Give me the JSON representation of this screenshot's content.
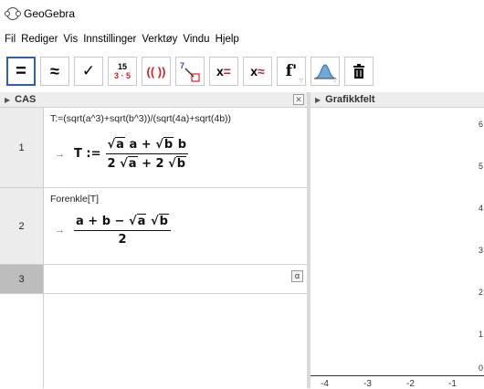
{
  "window": {
    "title": "GeoGebra"
  },
  "menu": [
    "Fil",
    "Rediger",
    "Vis",
    "Innstillinger",
    "Verktøy",
    "Vindu",
    "Hjelp"
  ],
  "toolbar": {
    "tools": [
      {
        "name": "evaluate-tool",
        "glyph": "="
      },
      {
        "name": "numeric-tool",
        "glyph": "≈"
      },
      {
        "name": "keep-input-tool",
        "glyph": "✓"
      },
      {
        "name": "factor-tool",
        "glyph_top": "15",
        "glyph_bottom": "3 · 5"
      },
      {
        "name": "expand-tool",
        "glyph": "(( ))"
      },
      {
        "name": "substitute-tool",
        "glyph": "7"
      },
      {
        "name": "solve-tool",
        "glyph": "x ="
      },
      {
        "name": "solve-numerically-tool",
        "glyph": "x ≈"
      },
      {
        "name": "derivative-tool",
        "glyph": "f'"
      },
      {
        "name": "probability-tool",
        "glyph": ""
      },
      {
        "name": "delete-tool",
        "glyph": ""
      }
    ]
  },
  "cas": {
    "header": "CAS",
    "rows": [
      {
        "number": "1",
        "input": "T:=(sqrt(a^3)+sqrt(b^3))/(sqrt(4a)+sqrt(4b))",
        "output_arrow": "→",
        "output_lhs": "T :=",
        "num_a": "a",
        "num_a2": "a",
        "num_plus": "+",
        "num_b": "b",
        "num_b2": "b",
        "den_2a": "2",
        "den_a": "a",
        "den_plus": "+ 2",
        "den_b": "b"
      },
      {
        "number": "2",
        "input": "Forenkle[T]",
        "output_arrow": "→",
        "num_text": "a + b −",
        "num_a": "a",
        "num_b": "b",
        "den": "2"
      },
      {
        "number": "3",
        "alpha": "α"
      }
    ]
  },
  "graphics": {
    "header": "Grafikkfelt",
    "x_ticks": [
      "-4",
      "-3",
      "-2",
      "-1"
    ],
    "y_ticks": [
      "6",
      "5",
      "4",
      "3",
      "2",
      "1",
      "0"
    ]
  }
}
